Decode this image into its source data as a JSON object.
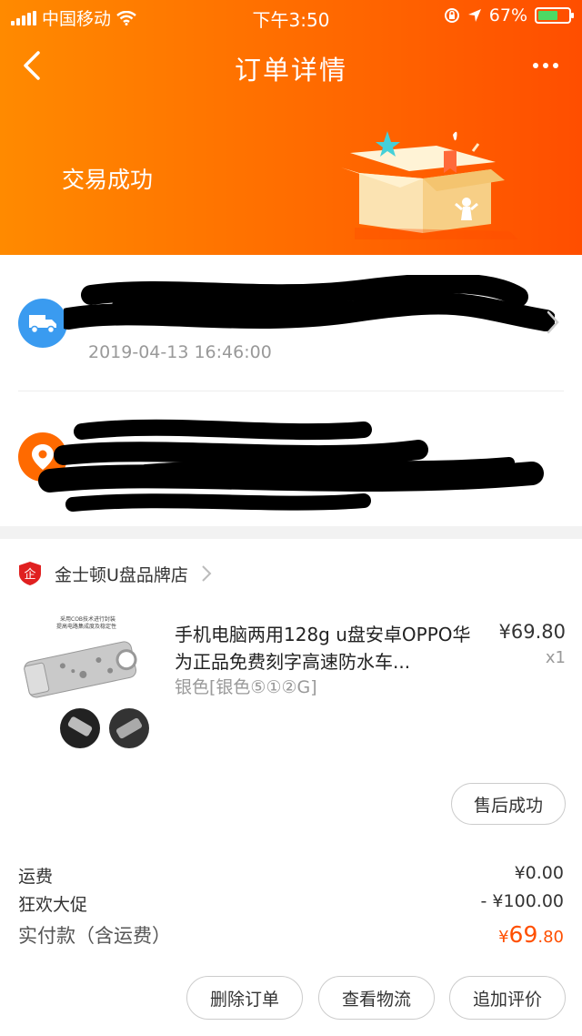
{
  "status_bar": {
    "carrier": "中国移动",
    "time": "下午3:50",
    "battery_percent": "67%",
    "battery_level": 0.67,
    "battery_color": "#4cd964"
  },
  "nav": {
    "title": "订单详情",
    "back_icon": "chevron-left-icon",
    "more_icon": "more-dots-icon"
  },
  "header": {
    "status_text": "交易成功",
    "background_colors": [
      "#ff8a00",
      "#ff4e00"
    ]
  },
  "logistics": {
    "icon": "truck-icon",
    "time": "2019-04-13 16:46:00"
  },
  "address": {
    "icon": "location-pin-icon"
  },
  "shop": {
    "name": "金士顿U盘品牌店",
    "badge_char": "企",
    "icon": "shop-badge-icon"
  },
  "product": {
    "title": "手机电脑两用128g u盘安卓OPPO华为正品免费刻字高速防水车...",
    "price": "¥69.80",
    "quantity": "x1",
    "sku": "银色[银色⑤①②G]",
    "image_tagline_1": "采用COB技术进行封装",
    "image_tagline_2": "提高电路集成度及稳定性"
  },
  "aftersale": {
    "label": "售后成功"
  },
  "fees": {
    "shipping_label": "运费",
    "shipping_value": "¥0.00",
    "promo_label": "狂欢大促",
    "promo_value": "- ¥100.00",
    "total_label": "实付款（含运费）",
    "total_currency": "¥",
    "total_int": "69",
    "total_dec": ".80"
  },
  "actions": {
    "delete": "删除订单",
    "logistics": "查看物流",
    "review": "追加评价"
  },
  "colors": {
    "accent": "#ff4f00",
    "blue": "#3a9bf0"
  }
}
